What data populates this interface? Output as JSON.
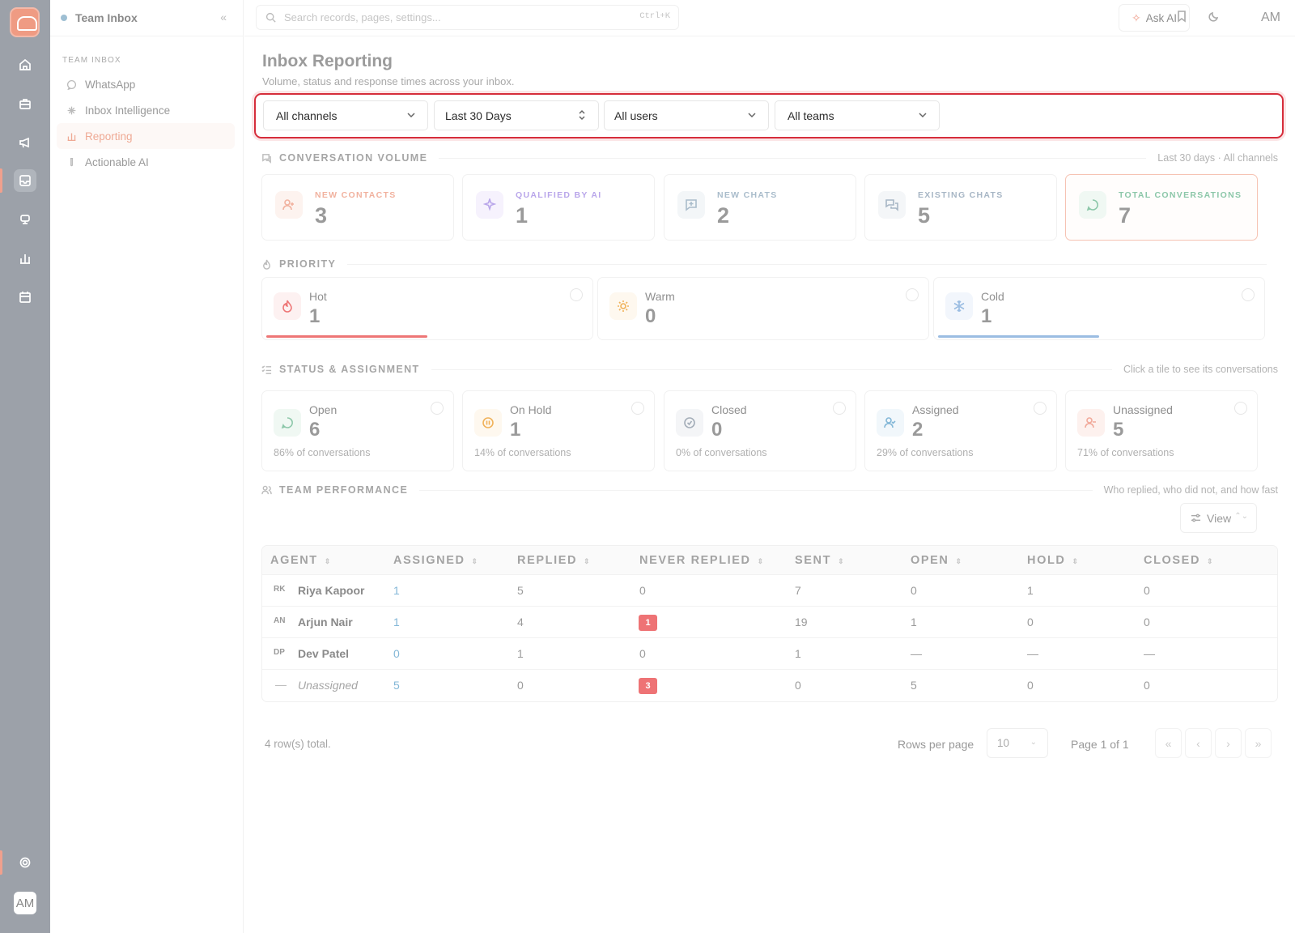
{
  "app": {
    "workspace": "Team Inbox",
    "user_initials": "AM"
  },
  "sidebar": {
    "section": "TEAM INBOX",
    "items": [
      {
        "label": "WhatsApp",
        "icon": "whatsapp-icon"
      },
      {
        "label": "Inbox Intelligence",
        "icon": "sparkle-icon"
      },
      {
        "label": "Reporting",
        "icon": "bar-chart-icon",
        "active": true
      },
      {
        "label": "Actionable AI",
        "icon": "flask-icon"
      }
    ]
  },
  "topbar": {
    "search_placeholder": "Search records, pages, settings...",
    "shortcut": "Ctrl+K",
    "ask_ai": "Ask AI",
    "avatar": "AM"
  },
  "page": {
    "title": "Inbox Reporting",
    "subtitle": "Volume, status and response times across your inbox."
  },
  "filters": {
    "channel": "All channels",
    "period": "Last 30 Days",
    "users": "All users",
    "teams": "All teams"
  },
  "volume": {
    "title": "CONVERSATION VOLUME",
    "note": "Last 30 days · All channels",
    "cards": [
      {
        "label": "NEW CONTACTS",
        "value": "3",
        "color": "#f1b29f"
      },
      {
        "label": "QUALIFIED BY AI",
        "value": "1",
        "color": "#b9a6ea"
      },
      {
        "label": "NEW CHATS",
        "value": "2",
        "color": "#a9bccb"
      },
      {
        "label": "EXISTING CHATS",
        "value": "5",
        "color": "#a7b6c5"
      },
      {
        "label": "TOTAL CONVERSATIONS",
        "value": "7",
        "color": "#8cc7a9"
      }
    ]
  },
  "priority": {
    "title": "PRIORITY",
    "cards": [
      {
        "label": "Hot",
        "value": "1",
        "bar_fraction": 0.5,
        "bar_color": "#ee7676"
      },
      {
        "label": "Warm",
        "value": "0",
        "bar_fraction": 0,
        "bar_color": "#f0b25a"
      },
      {
        "label": "Cold",
        "value": "1",
        "bar_fraction": 0.5,
        "bar_color": "#9bbde2"
      }
    ]
  },
  "status": {
    "title": "STATUS & ASSIGNMENT",
    "note": "Click a tile to see its conversations",
    "cards": [
      {
        "label": "Open",
        "value": "6",
        "pct": "86% of conversations"
      },
      {
        "label": "On Hold",
        "value": "1",
        "pct": "14% of conversations"
      },
      {
        "label": "Closed",
        "value": "0",
        "pct": "0% of conversations"
      },
      {
        "label": "Assigned",
        "value": "2",
        "pct": "29% of conversations"
      },
      {
        "label": "Unassigned",
        "value": "5",
        "pct": "71% of conversations"
      }
    ]
  },
  "team": {
    "title": "TEAM PERFORMANCE",
    "note": "Who replied, who did not, and how fast",
    "view_label": "View",
    "columns": [
      "AGENT",
      "ASSIGNED",
      "REPLIED",
      "NEVER REPLIED",
      "SENT",
      "OPEN",
      "HOLD",
      "CLOSED"
    ],
    "rows": [
      {
        "initials": "RK",
        "agent": "Riya Kapoor",
        "assigned": "1",
        "replied": "5",
        "never_replied": "0",
        "sent": "7",
        "open": "0",
        "hold": "1",
        "closed": "0"
      },
      {
        "initials": "AN",
        "agent": "Arjun Nair",
        "assigned": "1",
        "replied": "4",
        "never_replied": "1",
        "sent": "19",
        "open": "1",
        "hold": "0",
        "closed": "0"
      },
      {
        "initials": "DP",
        "agent": "Dev Patel",
        "assigned": "0",
        "replied": "1",
        "never_replied": "0",
        "sent": "1",
        "open": "—",
        "hold": "—",
        "closed": "—"
      },
      {
        "initials": "—",
        "agent": "Unassigned",
        "assigned": "5",
        "replied": "0",
        "never_replied": "3",
        "sent": "0",
        "open": "5",
        "hold": "0",
        "closed": "0"
      }
    ],
    "total_text": "4 row(s) total.",
    "rows_per_page_label": "Rows per page",
    "rows_per_page": "10",
    "page_text": "Page 1 of 1"
  }
}
